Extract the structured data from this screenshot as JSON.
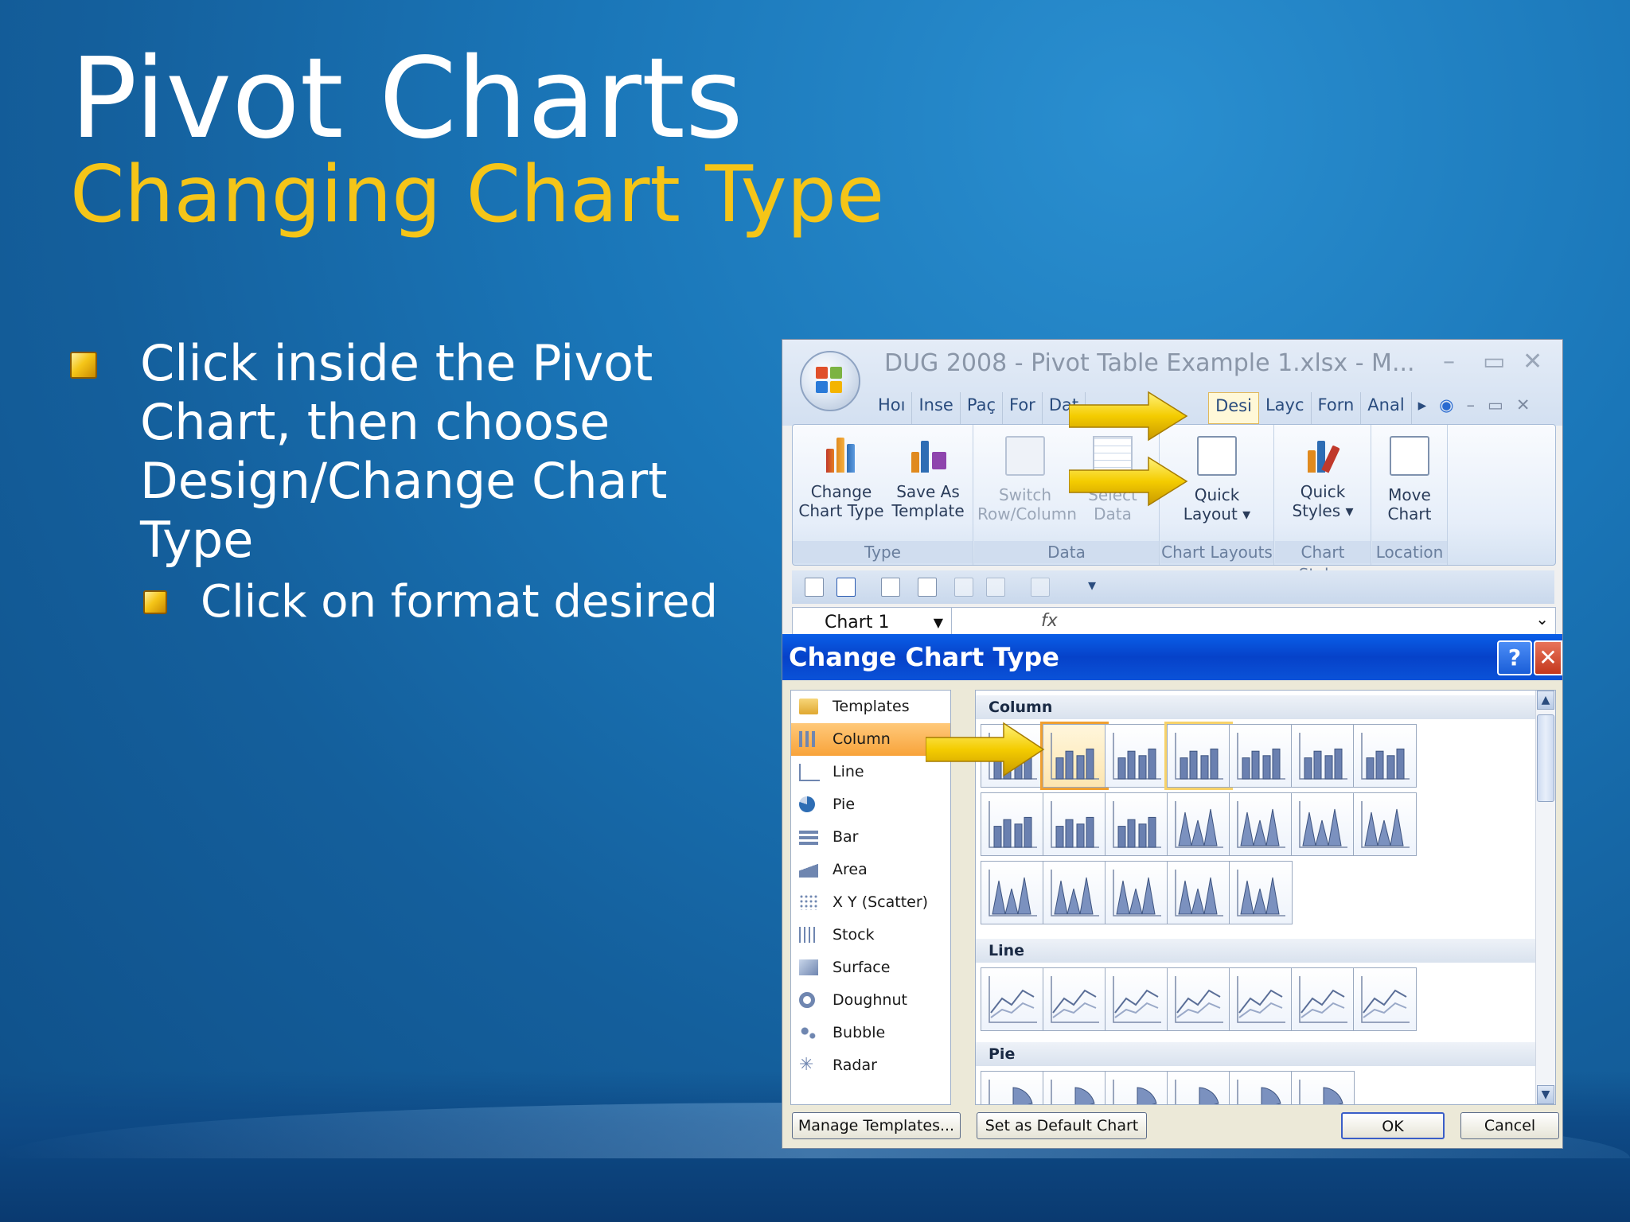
{
  "slide": {
    "title": "Pivot Charts",
    "subtitle": "Changing Chart Type",
    "bullet1": "Click inside the Pivot Chart, then choose Design/Change Chart Type",
    "bullet2": "Click on format desired"
  },
  "excel": {
    "window_title": "DUG 2008 - Pivot Table Example 1.xlsx - M...",
    "tabs": [
      "Hoı",
      "Inse",
      "Paç",
      "For",
      "Dat",
      "Desi",
      "Layc",
      "Forn",
      "Anal"
    ],
    "ribbon": {
      "groups": [
        {
          "label": "Type",
          "buttons": [
            {
              "label": "Change Chart Type"
            },
            {
              "label": "Save As Template"
            }
          ]
        },
        {
          "label": "Data",
          "buttons": [
            {
              "label": "Switch Row/Column"
            },
            {
              "label": "Select Data"
            }
          ]
        },
        {
          "label": "Chart Layouts",
          "buttons": [
            {
              "label": "Quick Layout ▾"
            }
          ]
        },
        {
          "label": "Chart Styles",
          "buttons": [
            {
              "label": "Quick Styles ▾"
            }
          ]
        },
        {
          "label": "Location",
          "buttons": [
            {
              "label": "Move Chart"
            }
          ]
        }
      ]
    },
    "name_box": "Chart 1",
    "fx": "fx"
  },
  "dialog": {
    "title": "Change Chart Type",
    "help": "?",
    "close": "✕",
    "categories": [
      "Templates",
      "Column",
      "Line",
      "Pie",
      "Bar",
      "Area",
      "X Y (Scatter)",
      "Stock",
      "Surface",
      "Doughnut",
      "Bubble",
      "Radar"
    ],
    "selected_category": "Column",
    "sections": [
      "Column",
      "Line",
      "Pie"
    ],
    "buttons": {
      "manage_templates": "Manage Templates...",
      "set_default": "Set as Default Chart",
      "ok": "OK",
      "cancel": "Cancel"
    }
  },
  "colors": {
    "title": "#ffffff",
    "subtitle": "#f5c518",
    "arrow": "#f4cc00"
  }
}
